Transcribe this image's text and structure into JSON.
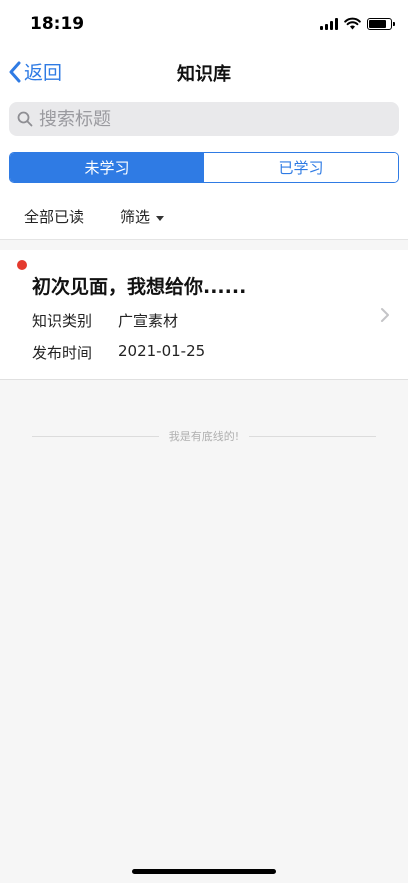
{
  "status_bar": {
    "time": "18:19"
  },
  "nav": {
    "back_label": "返回",
    "title": "知识库"
  },
  "search": {
    "placeholder": "搜索标题",
    "value": ""
  },
  "segments": [
    {
      "label": "未学习",
      "active": true
    },
    {
      "label": "已学习",
      "active": false
    }
  ],
  "filter": {
    "mark_all_read": "全部已读",
    "filter_label": "筛选"
  },
  "items": [
    {
      "title": "初次见面，我想给你......",
      "unread": true,
      "category_key": "知识类别",
      "category_value": "广宣素材",
      "date_key": "发布时间",
      "date_value": "2021-01-25"
    }
  ],
  "footer_hint": "我是有底线的!",
  "colors": {
    "accent": "#2f7be4",
    "unread_dot": "#e43a2e",
    "background": "#f6f6f6"
  }
}
